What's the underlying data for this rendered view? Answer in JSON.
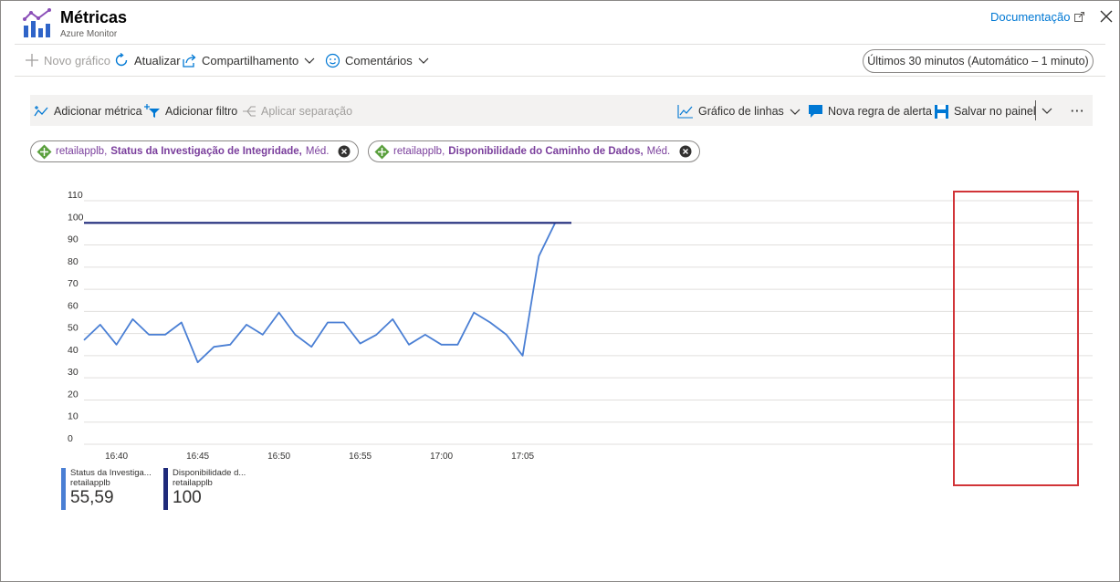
{
  "header": {
    "title": "Métricas",
    "subtitle": "Azure Monitor",
    "doc_link": "Documentação"
  },
  "command_bar": {
    "new_chart": "Novo gráfico",
    "refresh": "Atualizar",
    "share": "Compartilhamento",
    "feedback": "Comentários",
    "time_range": "Últimos 30 minutos (Automático – 1 minuto)"
  },
  "chart_toolbar": {
    "add_metric": "Adicionar métrica",
    "add_filter": "Adicionar filtro",
    "apply_split": "Aplicar separação",
    "chart_type": "Gráfico de linhas",
    "new_alert": "Nova regra de alerta",
    "save_dashboard": "Salvar no painel",
    "more": "···"
  },
  "metric_pills": [
    {
      "resource": "retailapplb,",
      "metric": "Status da Investigação de Integridade,",
      "aggregation": "Méd."
    },
    {
      "resource": "retailapplb,",
      "metric": "Disponibilidade do Caminho de Dados,",
      "aggregation": "Méd."
    }
  ],
  "legend": [
    {
      "name": "Status da Investiga...",
      "resource": "retailapplb",
      "value": "55,59",
      "color": "#4a7fd4"
    },
    {
      "name": "Disponibilidade d...",
      "resource": "retailapplb",
      "value": "100",
      "color": "#1f2a7a"
    }
  ],
  "chart_data": {
    "type": "line",
    "ylim": [
      0,
      110
    ],
    "yticks": [
      "0",
      "10",
      "20",
      "30",
      "40",
      "50",
      "60",
      "70",
      "80",
      "90",
      "100",
      "110"
    ],
    "xticks": [
      "16:40",
      "16:45",
      "16:50",
      "16:55",
      "17:00",
      "17:05"
    ],
    "x_start_minute": "16:38",
    "series": [
      {
        "name": "Status da Investigação de Integridade",
        "color": "#4a7fd4",
        "x": [
          "16:38",
          "16:39",
          "16:40",
          "16:41",
          "16:42",
          "16:43",
          "16:44",
          "16:45",
          "16:46",
          "16:47",
          "16:48",
          "16:49",
          "16:50",
          "16:51",
          "16:52",
          "16:53",
          "16:54",
          "16:55",
          "16:56",
          "16:57",
          "16:58",
          "16:59",
          "17:00",
          "17:01",
          "17:02",
          "17:03",
          "17:04",
          "17:05",
          "17:06",
          "17:07"
        ],
        "values": [
          47,
          54,
          45,
          56.5,
          49.5,
          49.5,
          55,
          37,
          44,
          45,
          54,
          49.5,
          59.5,
          49.5,
          44,
          55,
          55,
          45.5,
          49.5,
          56.5,
          45,
          49.5,
          45,
          45,
          59.5,
          55,
          49.5,
          40,
          85,
          100
        ]
      },
      {
        "name": "Disponibilidade do Caminho de Dados",
        "color": "#1f2a7a",
        "x": [
          "16:38",
          "17:08"
        ],
        "values": [
          100,
          100
        ]
      }
    ]
  }
}
